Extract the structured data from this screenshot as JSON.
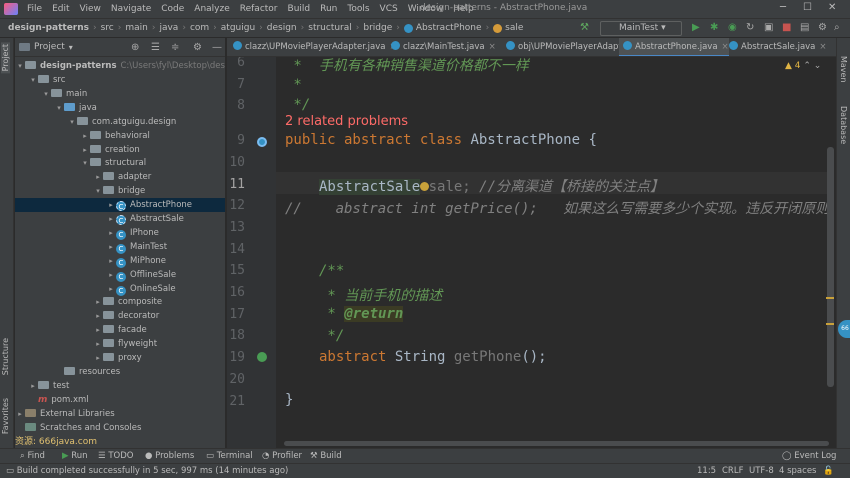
{
  "menu": [
    "File",
    "Edit",
    "View",
    "Navigate",
    "Code",
    "Analyze",
    "Refactor",
    "Build",
    "Run",
    "Tools",
    "VCS",
    "Window",
    "Help"
  ],
  "window_title": "design-patterns - AbstractPhone.java",
  "breadcrumbs": [
    "design-patterns",
    "src",
    "main",
    "java",
    "com",
    "atguigu",
    "design",
    "structural",
    "bridge",
    "AbstractPhone",
    "sale"
  ],
  "run_config": "MainTest",
  "project_panel": {
    "title": "Project",
    "root": "design-patterns",
    "root_path": "C:\\Users\\fyl\\Desktop\\design-patterns",
    "tree": [
      {
        "label": "src",
        "indent": 1,
        "kind": "folder",
        "arrow": "open"
      },
      {
        "label": "main",
        "indent": 2,
        "kind": "folder",
        "arrow": "open"
      },
      {
        "label": "java",
        "indent": 3,
        "kind": "folder-blue",
        "arrow": "open"
      },
      {
        "label": "com.atguigu.design",
        "indent": 4,
        "kind": "folder",
        "arrow": "open"
      },
      {
        "label": "behavioral",
        "indent": 5,
        "kind": "folder",
        "arrow": "closed"
      },
      {
        "label": "creation",
        "indent": 5,
        "kind": "folder",
        "arrow": "closed"
      },
      {
        "label": "structural",
        "indent": 5,
        "kind": "folder",
        "arrow": "open"
      },
      {
        "label": "adapter",
        "indent": 6,
        "kind": "folder",
        "arrow": "closed"
      },
      {
        "label": "bridge",
        "indent": 6,
        "kind": "folder",
        "arrow": "open"
      },
      {
        "label": "AbstractPhone",
        "indent": 7,
        "kind": "abstract",
        "arrow": "closed",
        "selected": true
      },
      {
        "label": "AbstractSale",
        "indent": 7,
        "kind": "abstract",
        "arrow": "closed"
      },
      {
        "label": "IPhone",
        "indent": 7,
        "kind": "class",
        "arrow": "closed"
      },
      {
        "label": "MainTest",
        "indent": 7,
        "kind": "class",
        "arrow": "closed"
      },
      {
        "label": "MiPhone",
        "indent": 7,
        "kind": "class",
        "arrow": "closed"
      },
      {
        "label": "OfflineSale",
        "indent": 7,
        "kind": "class",
        "arrow": "closed"
      },
      {
        "label": "OnlineSale",
        "indent": 7,
        "kind": "class",
        "arrow": "closed"
      },
      {
        "label": "composite",
        "indent": 6,
        "kind": "folder",
        "arrow": "closed"
      },
      {
        "label": "decorator",
        "indent": 6,
        "kind": "folder",
        "arrow": "closed"
      },
      {
        "label": "facade",
        "indent": 6,
        "kind": "folder",
        "arrow": "closed"
      },
      {
        "label": "flyweight",
        "indent": 6,
        "kind": "folder",
        "arrow": "closed"
      },
      {
        "label": "proxy",
        "indent": 6,
        "kind": "folder",
        "arrow": "closed"
      },
      {
        "label": "resources",
        "indent": 3,
        "kind": "folder",
        "arrow": "none"
      },
      {
        "label": "test",
        "indent": 1,
        "kind": "folder",
        "arrow": "closed"
      },
      {
        "label": "pom.xml",
        "indent": 1,
        "kind": "maven",
        "arrow": "none"
      },
      {
        "label": "External Libraries",
        "indent": 0,
        "kind": "lib",
        "arrow": "closed"
      },
      {
        "label": "Scratches and Consoles",
        "indent": 0,
        "kind": "scratch",
        "arrow": "none"
      }
    ],
    "watermark": "资源: 666java.com"
  },
  "tabs": [
    {
      "label": "clazz\\UPMoviePlayerAdapter.java",
      "active": false
    },
    {
      "label": "clazz\\MainTest.java",
      "active": false
    },
    {
      "label": "obj\\UPMoviePlayerAdapter.java",
      "active": false
    },
    {
      "label": "AbstractPhone.java",
      "active": true
    },
    {
      "label": "AbstractSale.java",
      "active": false
    }
  ],
  "editor": {
    "warning_count": "4",
    "line_numbers": [
      "6",
      "7",
      "8",
      "9",
      "10",
      "11",
      "12",
      "13",
      "14",
      "15",
      "16",
      "17",
      "18",
      "19",
      "20",
      "21"
    ],
    "current_line": "11",
    "related_problems": "2 related problems",
    "code": {
      "l6_comment": " *  手机有各种销售渠道价格都不一样",
      "l7": " *",
      "l8": " */",
      "l9_kw": "public abstract class",
      "l9_name": " AbstractPhone {",
      "l11_type": "AbstractSale",
      "l11_var": " sale; ",
      "l11_comment": "//分离渠道【桥接的关注点】",
      "l12_prefix": "//",
      "l12_kw": "    abstract int",
      "l12_rest": " getPrice();",
      "l12_comment": "   如果这么写需要多少个实现。违反开闭原则",
      "l15": "/**",
      "l16": " * 当前手机的描述",
      "l17_star": " * ",
      "l17_tag": "@return",
      "l18": " */",
      "l19_kw": "abstract",
      "l19_type": " String ",
      "l19_name": "getPhone",
      "l19_rest": "();",
      "l21": "}"
    }
  },
  "bottom_tools": [
    "Find",
    "Run",
    "TODO",
    "Problems",
    "Terminal",
    "Profiler",
    "Build"
  ],
  "event_log": "Event Log",
  "status": {
    "message": "Build completed successfully in 5 sec, 997 ms (14 minutes ago)",
    "position": "11:5",
    "line_sep": "CRLF",
    "encoding": "UTF-8",
    "indent": "4 spaces"
  },
  "side_tools": {
    "left": [
      "Project",
      "Structure",
      "Favorites"
    ],
    "right": [
      "Maven",
      "Database"
    ]
  },
  "bubble": "66"
}
